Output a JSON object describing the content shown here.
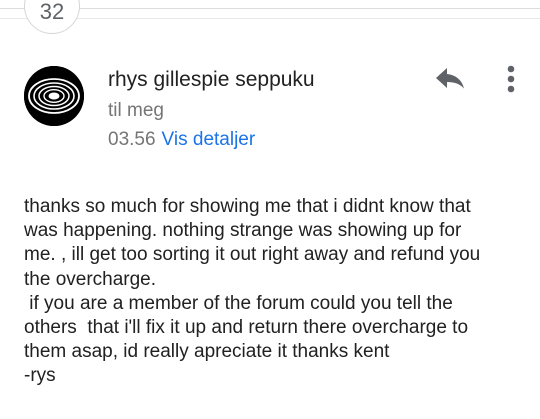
{
  "thread": {
    "message_count": "32"
  },
  "message": {
    "sender": "rhys gillespie seppuku",
    "recipient": "til meg",
    "time": "03.56",
    "details_link": "Vis detaljer",
    "body_lines": [
      "thanks so much for showing me that i didnt know that",
      "was happening. nothing strange was showing up for",
      "me. , ill get too sorting it out right away and refund you",
      "the overcharge.",
      " if you are a member of the forum could you tell the",
      "others  that i'll fix it up and return there overcharge to",
      "them asap, id really apreciate it thanks kent",
      "-rys"
    ]
  },
  "actions": {
    "reply_icon": "reply-icon",
    "more_icon": "more-vert-icon"
  },
  "colors": {
    "link": "#1a73e8",
    "secondary_text": "#757575",
    "icon": "#5f6368"
  }
}
